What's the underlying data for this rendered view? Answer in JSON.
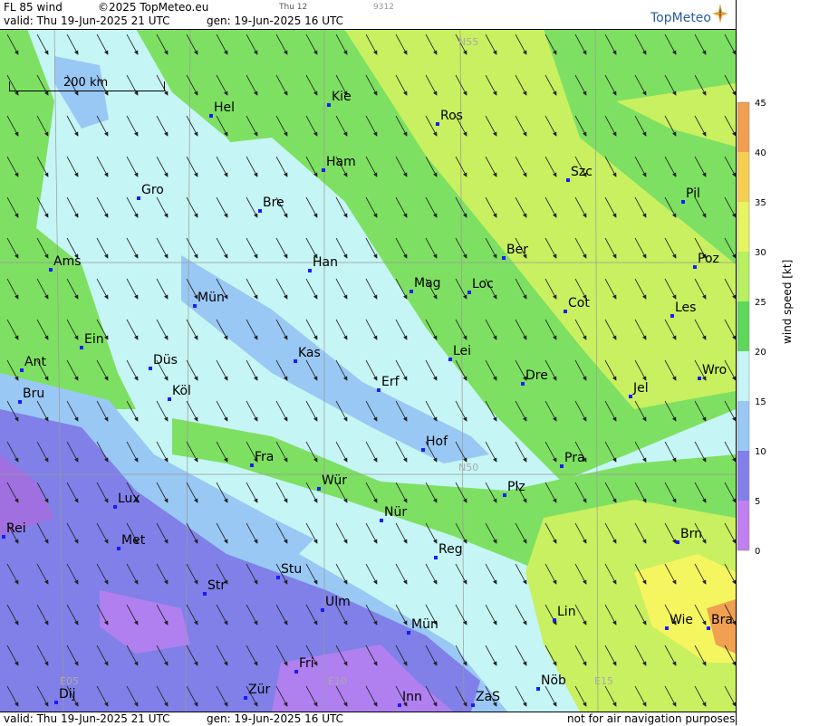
{
  "header": {
    "product": "FL 85 wind",
    "copyright": "©2025 TopMeteo.eu",
    "small_day": "Thu 12",
    "small_id": "9312",
    "valid": "valid:  Thu  19-Jun-2025  21 UTC",
    "generated": "gen: 19-Jun-2025 16 UTC",
    "logo": "TopMeteo"
  },
  "footer": {
    "valid": "valid:  Thu  19-Jun-2025  21 UTC",
    "generated": "gen: 19-Jun-2025 16 UTC",
    "disclaimer": "not for air navigation purposes"
  },
  "scale": {
    "label": "200 km"
  },
  "legend": {
    "unit": "wind speed  [kt]",
    "ticks": [
      "45",
      "40",
      "35",
      "30",
      "25",
      "20",
      "15",
      "10",
      "5",
      "0"
    ],
    "colors": [
      "#e06050",
      "#f0a050",
      "#f5d050",
      "#f5f560",
      "#c8f060",
      "#8ee860",
      "#5ed85a",
      "#c6f5f5",
      "#99c8f5",
      "#8080e8",
      "#9a6be0",
      "#c080f0"
    ]
  },
  "grid_labels": [
    "N55",
    "N50",
    "E05",
    "E10",
    "E15"
  ],
  "cities": [
    {
      "name": "Hel"
    },
    {
      "name": "Kie"
    },
    {
      "name": "Ros"
    },
    {
      "name": "Ham"
    },
    {
      "name": "Szc"
    },
    {
      "name": "Gro"
    },
    {
      "name": "Bre"
    },
    {
      "name": "Pil"
    },
    {
      "name": "Ams"
    },
    {
      "name": "Han"
    },
    {
      "name": "Ber"
    },
    {
      "name": "Poz"
    },
    {
      "name": "Mag"
    },
    {
      "name": "Loc"
    },
    {
      "name": "Mün"
    },
    {
      "name": "Cot"
    },
    {
      "name": "Les"
    },
    {
      "name": "Ein"
    },
    {
      "name": "Ant"
    },
    {
      "name": "Düs"
    },
    {
      "name": "Kas"
    },
    {
      "name": "Lei"
    },
    {
      "name": "Wro"
    },
    {
      "name": "Bru"
    },
    {
      "name": "Köl"
    },
    {
      "name": "Erf"
    },
    {
      "name": "Dre"
    },
    {
      "name": "Jel"
    },
    {
      "name": "Hof"
    },
    {
      "name": "Fra"
    },
    {
      "name": "Pra"
    },
    {
      "name": "Wür"
    },
    {
      "name": "Plz"
    },
    {
      "name": "Lux"
    },
    {
      "name": "Nür"
    },
    {
      "name": "Rei"
    },
    {
      "name": "Met"
    },
    {
      "name": "Reg"
    },
    {
      "name": "Brn"
    },
    {
      "name": "Stu"
    },
    {
      "name": "Str"
    },
    {
      "name": "Ulm"
    },
    {
      "name": "Lin"
    },
    {
      "name": "Wie"
    },
    {
      "name": "Bra"
    },
    {
      "name": "Mün"
    },
    {
      "name": "Fri"
    },
    {
      "name": "Nöb"
    },
    {
      "name": "Dij"
    },
    {
      "name": "Zür"
    },
    {
      "name": "Inn"
    },
    {
      "name": "ZaS"
    }
  ]
}
